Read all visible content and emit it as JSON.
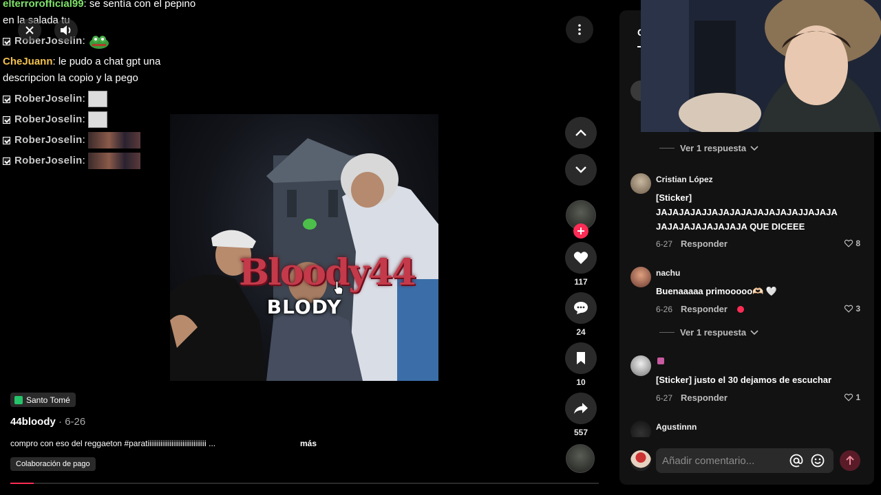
{
  "chat": {
    "lines": [
      {
        "user": "elterrorofficial99",
        "msg": ": se sentía con el pepino en la salada tu"
      },
      {
        "user": "RoberJoselin",
        "msg": ":",
        "emote": "frog-emote"
      },
      {
        "user": "CheJuann",
        "msg": ": le pudo a chat gpt una descripcion la copio y la pego"
      },
      {
        "user": "RoberJoselin",
        "msg": ":",
        "emote": "thumb-emote"
      },
      {
        "user": "RoberJoselin",
        "msg": ":",
        "emote": "thumb-emote"
      },
      {
        "user": "RoberJoselin",
        "msg": ":",
        "emote": "wide-emote"
      },
      {
        "user": "RoberJoselin",
        "msg": ":",
        "emote": "wide-emote"
      }
    ]
  },
  "video": {
    "logo_text": "Bloody44",
    "caption": "BLODY",
    "location": "Santo Tomé",
    "author": "44bloody",
    "date": "· 6-26",
    "description": "compro con eso del reggaeton #paratiiiiiiiiiiiiiiiiiiiiiiiiiiiiiiii ...",
    "more": "más",
    "paid_label": "Colaboración de pago",
    "progress": 0.04
  },
  "rail": {
    "likes": "117",
    "comments": "24",
    "saves": "10",
    "shares": "557"
  },
  "panel": {
    "tab": "C",
    "replies_1": "Ver 1 respuesta",
    "replies_2": "Ver 1 respuesta",
    "comments": [
      {
        "name": "Cristian López",
        "text": "[Sticker] JAJAJAJAJJAJAJAJAJAJAJAJAJJAJAJA JAJAJAJAJAJAJAJA QUE DICEEE",
        "date": "6-27",
        "reply": "Responder",
        "likes": "8"
      },
      {
        "name": "nachu",
        "text": "Buenaaaaa primooooo🫶🏻 🤍",
        "date": "6-26",
        "reply": "Responder",
        "likes": "3"
      },
      {
        "name": "",
        "text": "[Sticker] justo el 30 dejamos de escuchar",
        "date": "6-27",
        "reply": "Responder",
        "likes": "1"
      },
      {
        "name": "Agustinnn",
        "text": "",
        "date": "",
        "reply": "",
        "likes": ""
      }
    ],
    "input_placeholder": "Añadir comentario..."
  },
  "colors": {
    "accent": "#fe2c55",
    "panel_bg": "#121212",
    "chat_green": "#7fe36a",
    "chat_gold": "#f2c14e"
  }
}
